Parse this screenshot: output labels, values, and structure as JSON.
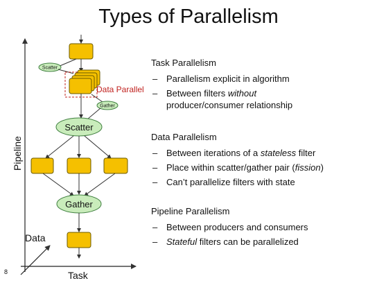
{
  "slide": {
    "title": "Types of Parallelism",
    "page_number": "8",
    "dash": "–"
  },
  "diagram": {
    "axis_pipeline": "Pipeline",
    "axis_task": "Task",
    "axis_data": "Data",
    "scatter_label": "Scatter",
    "gather_label": "Gather",
    "small_scatter_label": "Scatter",
    "small_gather_label": "Gather",
    "data_parallel_label": "Data Parallel",
    "filter_fill": "#f5c000",
    "ellipse_fill": "#c9ecbb",
    "ellipse_stroke": "#3f7f3f",
    "accent_red": "#c0211e"
  },
  "sections": [
    {
      "heading": "Task Parallelism",
      "bullets": [
        {
          "parts": [
            {
              "t": "Parallelism explicit in algorithm"
            }
          ]
        },
        {
          "parts": [
            {
              "t": "Between filters "
            },
            {
              "t": "without",
              "i": true
            }
          ]
        },
        {
          "parts": [
            {
              "t": "producer/consumer relationship"
            }
          ]
        }
      ]
    },
    {
      "heading": "Data Parallelism",
      "bullets": [
        {
          "parts": [
            {
              "t": "Between iterations of a "
            },
            {
              "t": "stateless",
              "i": true
            },
            {
              "t": " filter"
            }
          ]
        },
        {
          "parts": [
            {
              "t": "Place within scatter/gather pair ("
            },
            {
              "t": "fission",
              "i": true
            },
            {
              "t": ")"
            }
          ]
        },
        {
          "parts": [
            {
              "t": "Can’t parallelize filters with state"
            }
          ]
        }
      ]
    },
    {
      "heading": "Pipeline Parallelism",
      "bullets": [
        {
          "parts": [
            {
              "t": "Between producers and consumers"
            }
          ]
        },
        {
          "parts": [
            {
              "t": "Stateful",
              "i": true
            },
            {
              "t": " filters can be parallelized"
            }
          ]
        }
      ]
    }
  ]
}
